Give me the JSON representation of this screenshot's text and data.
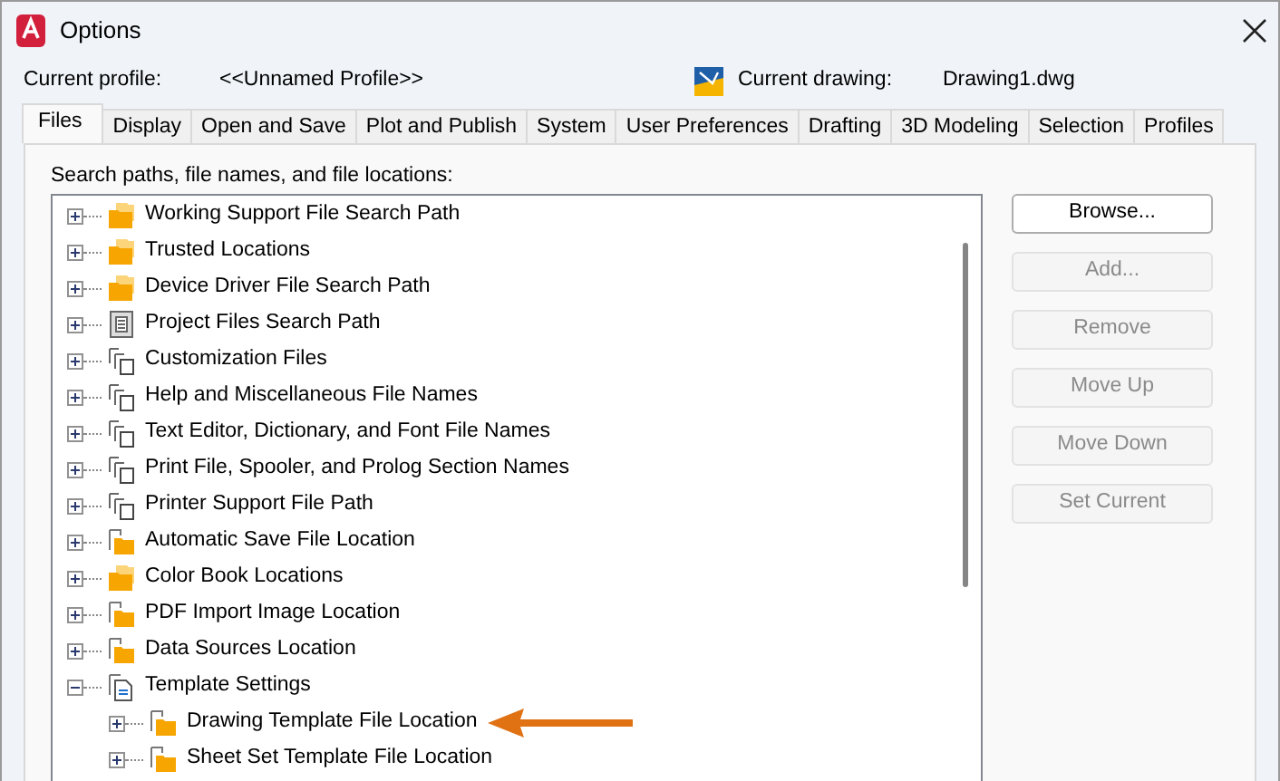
{
  "window": {
    "title": "Options"
  },
  "current_profile": {
    "label": "Current profile:",
    "value": "<<Unnamed Profile>>"
  },
  "current_drawing": {
    "label": "Current drawing:",
    "value": "Drawing1.dwg"
  },
  "tabs": [
    {
      "label": "Files",
      "selected": true
    },
    {
      "label": "Display",
      "selected": false
    },
    {
      "label": "Open and Save",
      "selected": false
    },
    {
      "label": "Plot and Publish",
      "selected": false
    },
    {
      "label": "System",
      "selected": false
    },
    {
      "label": "User Preferences",
      "selected": false
    },
    {
      "label": "Drafting",
      "selected": false
    },
    {
      "label": "3D Modeling",
      "selected": false
    },
    {
      "label": "Selection",
      "selected": false
    },
    {
      "label": "Profiles",
      "selected": false
    }
  ],
  "section_label": "Search paths, file names, and file locations:",
  "tree": [
    {
      "label": "Working Support File Search Path",
      "kind": "folders",
      "expanded": false
    },
    {
      "label": "Trusted Locations",
      "kind": "folders",
      "expanded": false
    },
    {
      "label": "Device Driver File Search Path",
      "kind": "folders",
      "expanded": false
    },
    {
      "label": "Project Files Search Path",
      "kind": "project",
      "expanded": false
    },
    {
      "label": "Customization Files",
      "kind": "files",
      "expanded": false
    },
    {
      "label": "Help and Miscellaneous File Names",
      "kind": "files",
      "expanded": false
    },
    {
      "label": "Text Editor, Dictionary, and Font File Names",
      "kind": "files",
      "expanded": false
    },
    {
      "label": "Print File, Spooler, and Prolog Section Names",
      "kind": "files",
      "expanded": false
    },
    {
      "label": "Printer Support File Path",
      "kind": "files",
      "expanded": false
    },
    {
      "label": "Automatic Save File Location",
      "kind": "location",
      "expanded": false
    },
    {
      "label": "Color Book Locations",
      "kind": "folders",
      "expanded": false
    },
    {
      "label": "PDF Import Image Location",
      "kind": "location",
      "expanded": false
    },
    {
      "label": "Data Sources Location",
      "kind": "location",
      "expanded": false
    },
    {
      "label": "Template Settings",
      "kind": "template",
      "expanded": true,
      "children": [
        {
          "label": "Drawing Template File Location",
          "kind": "location",
          "expanded": false,
          "callout": true
        },
        {
          "label": "Sheet Set Template File Location",
          "kind": "location",
          "expanded": false
        }
      ]
    }
  ],
  "buttons": [
    {
      "label": "Browse...",
      "disabled": false
    },
    {
      "label": "Add...",
      "disabled": true
    },
    {
      "label": "Remove",
      "disabled": true
    },
    {
      "label": "Move Up",
      "disabled": true
    },
    {
      "label": "Move Down",
      "disabled": true
    },
    {
      "label": "Set Current",
      "disabled": true
    }
  ]
}
